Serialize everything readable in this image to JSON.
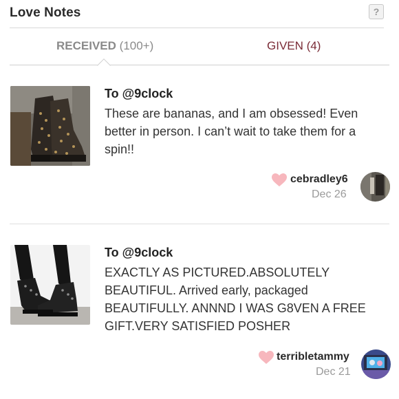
{
  "header": {
    "title": "Love Notes",
    "help_label": "?"
  },
  "tabs": {
    "received": {
      "label": "RECEIVED",
      "count": "(100+)"
    },
    "given": {
      "label": "GIVEN (4)"
    }
  },
  "notes": [
    {
      "to": "To @9clock",
      "message": "These are bananas, and I am obsessed! Even better in person. I can’t wait to take them for a spin!!",
      "author": "cebradley6",
      "date": "Dec 26"
    },
    {
      "to": "To @9clock",
      "message": "EXACTLY AS PICTURED.ABSOLUTELY BEAUTIFUL. Arrived early, packaged BEAUTIFULLY. ANNND I WAS G8VEN A FREE GIFT.VERY SATISFIED POSHER",
      "author": "terribletammy",
      "date": "Dec 21"
    }
  ],
  "colors": {
    "heart": "#f7b7bd",
    "given_tab": "#7a2b36",
    "muted": "#9a9a9a"
  }
}
